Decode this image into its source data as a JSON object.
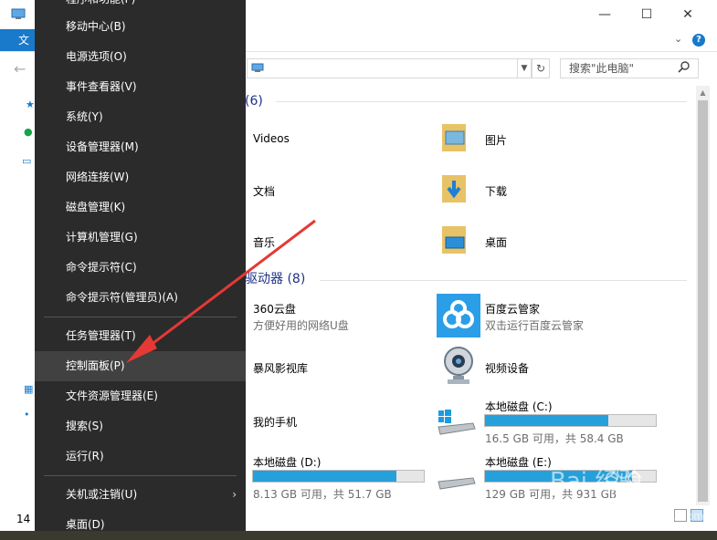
{
  "window": {
    "file_tab": "文件",
    "minimize": "—",
    "maximize": "☐",
    "close": "✕",
    "help": "?",
    "search_placeholder": "搜索\"此电脑\""
  },
  "groups": {
    "folders_header": "(6)",
    "drives_header": "驱动器 (8)"
  },
  "folders": [
    {
      "label": "Videos"
    },
    {
      "label": "图片"
    },
    {
      "label": "文档"
    },
    {
      "label": "下载"
    },
    {
      "label": "音乐"
    },
    {
      "label": "桌面"
    }
  ],
  "devices": [
    {
      "label": "360云盘",
      "sub": "方便好用的网络U盘"
    },
    {
      "label": "百度云管家",
      "sub": "双击运行百度云管家"
    },
    {
      "label": "暴风影视库"
    },
    {
      "label": "视频设备"
    },
    {
      "label": "我的手机"
    },
    {
      "label": "本地磁盘 (C:)",
      "sub": "16.5 GB 可用，共 58.4 GB",
      "usage": 0.72
    },
    {
      "label": "本地磁盘 (D:)",
      "sub": "8.13 GB 可用，共 51.7 GB",
      "usage": 0.84
    },
    {
      "label": "本地磁盘 (E:)",
      "sub": "129 GB 可用，共 931 GB",
      "usage": 0.86
    }
  ],
  "status": {
    "item_count": "14"
  },
  "menu": {
    "items": [
      {
        "label": "程序和功能(F)"
      },
      {
        "label": "移动中心(B)"
      },
      {
        "label": "电源选项(O)"
      },
      {
        "label": "事件查看器(V)"
      },
      {
        "label": "系统(Y)"
      },
      {
        "label": "设备管理器(M)"
      },
      {
        "label": "网络连接(W)"
      },
      {
        "label": "磁盘管理(K)"
      },
      {
        "label": "计算机管理(G)"
      },
      {
        "label": "命令提示符(C)"
      },
      {
        "label": "命令提示符(管理员)(A)"
      },
      {
        "label": "任务管理器(T)"
      },
      {
        "label": "控制面板(P)"
      },
      {
        "label": "文件资源管理器(E)"
      },
      {
        "label": "搜索(S)"
      },
      {
        "label": "运行(R)"
      },
      {
        "label": "关机或注销(U)"
      },
      {
        "label": "桌面(D)"
      }
    ],
    "hovered_index": 12
  },
  "watermark": {
    "text": "Bai 经验",
    "url": "jingyan.baidu.com"
  },
  "colors": {
    "menu_bg": "#2b2b2b",
    "menu_hover": "#414141",
    "accent": "#1979ca",
    "drive_bar": "#26a0da",
    "annotation": "#e53935"
  }
}
